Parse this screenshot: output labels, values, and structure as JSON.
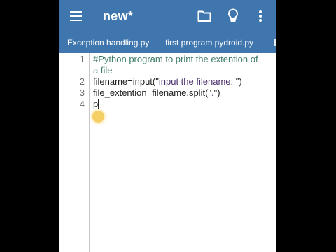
{
  "appbar": {
    "title": "new*",
    "icons": [
      "menu-icon",
      "folder-icon",
      "lightbulb-icon",
      "more-vert-icon"
    ],
    "color": "#3f76ad"
  },
  "tabs": [
    {
      "label": "Exception handling.py"
    },
    {
      "label": "first program pydroid.py"
    }
  ],
  "editor": {
    "line_numbers": [
      "1",
      "2",
      "3",
      "4"
    ],
    "lines": [
      {
        "text": "#Python program to print the extention of"
      },
      {
        "text": "a file"
      },
      {
        "prefix": "filename=input(\"",
        "string": "input the filename: ",
        "suffix": "\")"
      },
      {
        "prefix": "file_extention=filename.split(\"",
        "string": ".",
        "suffix": "\")"
      },
      {
        "text": "p"
      }
    ]
  }
}
